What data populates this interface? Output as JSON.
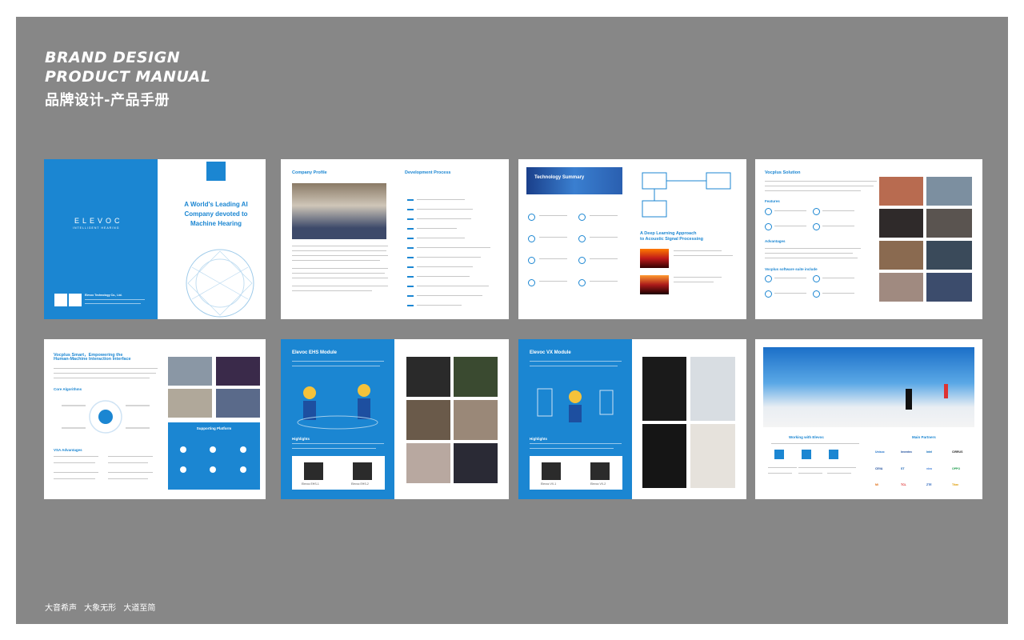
{
  "header": {
    "line1": "BRAND DESIGN",
    "line2": "PRODUCT MANUAL",
    "line3": "品牌设计-产品手册"
  },
  "tagline": "大音希声 大象无形 大道至简",
  "pages": {
    "cover": {
      "logo": "ELEVOC",
      "logo_sub": "INTELLIGENT HEARING",
      "headline1": "A World's Leading AI",
      "headline2": "Company devoted to",
      "headline3": "Machine Hearing",
      "company": "Elevoc Technology Co., Ltd."
    },
    "profile": {
      "title_left": "Company Profile",
      "title_right": "Development Process"
    },
    "tech": {
      "banner": "Technology Summary",
      "deep1": "A Deep Learning Approach",
      "deep2": "to Acoustic Signal Processing"
    },
    "solution": {
      "title": "Vocplus Solution",
      "features": "Features",
      "advantages": "Advantages",
      "suite": "Vocplus software suite include"
    },
    "smart": {
      "title1": "Vocplus Smart，Empowering the",
      "title2": "Human-Machine Interaction Interface",
      "core": "Core Algorithms",
      "vsa": "VSA Advantages",
      "platform": "Supporting Platform"
    },
    "ehs": {
      "title": "Elevoc EHS Module",
      "highlights": "Highlights",
      "board1": "Elevoc EHS-1",
      "board2": "Elevoc EHS-2"
    },
    "vx": {
      "title": "Elevoc VX Module",
      "highlights": "Highlights",
      "board1": "Elevoc VX-1",
      "board2": "Elevoc VX-2"
    },
    "partners": {
      "working": "Working with Elevoc",
      "main": "Main Partners",
      "brands": [
        "Unisoc",
        "Inventec",
        "Intel",
        "CIRRUS",
        "CEVA",
        "ST",
        "vivo",
        "OPPO",
        "Mi",
        "TCL",
        "ZTE",
        "Titan"
      ]
    }
  }
}
